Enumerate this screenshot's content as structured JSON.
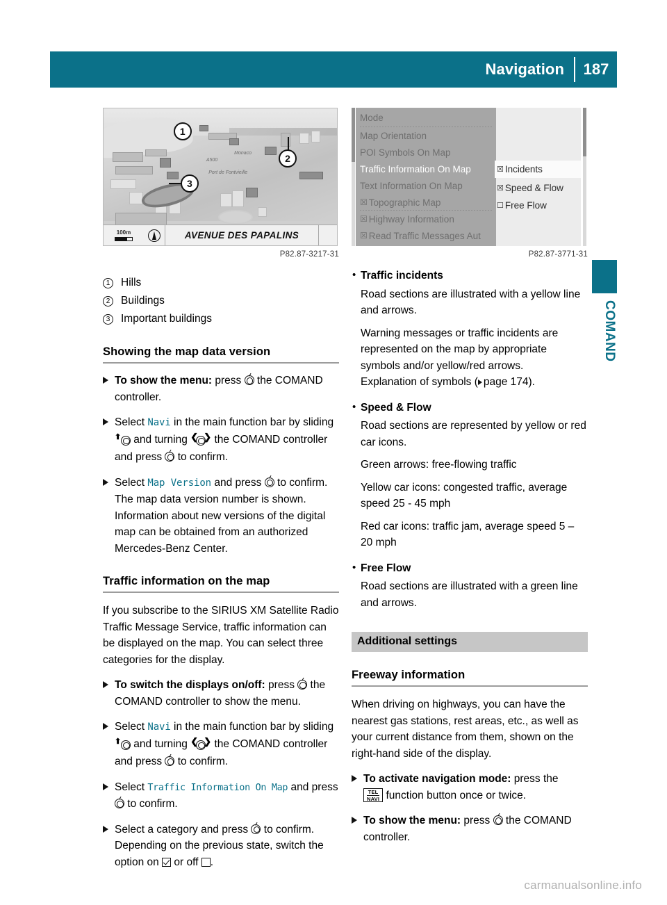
{
  "header": {
    "title": "Navigation",
    "page_number": "187"
  },
  "side_tab": {
    "label": "COMAND"
  },
  "figures": {
    "map": {
      "caption": "P82.87-3217-31",
      "street_label": "AVENUE DES PAPALINS",
      "scale": "100m",
      "place_labels": [
        "Monaco",
        "Port de Fontvieille",
        "A500"
      ],
      "callouts": [
        "1",
        "2",
        "3"
      ]
    },
    "menu": {
      "caption": "P82.87-3771-31",
      "items": [
        {
          "label": "Mode",
          "checkbox": "none",
          "selected": false
        },
        {
          "label": "Map Orientation",
          "checkbox": "none",
          "selected": false
        },
        {
          "label": "POI Symbols On Map",
          "checkbox": "none",
          "selected": false
        },
        {
          "label": "Traffic Information On Map",
          "checkbox": "none",
          "selected": true
        },
        {
          "label": "Text Information On Map",
          "checkbox": "none",
          "selected": false
        },
        {
          "label": "Topographic Map",
          "checkbox": "checked",
          "selected": false
        },
        {
          "label": "Highway Information",
          "checkbox": "checked",
          "selected": false
        },
        {
          "label": "Read Traffic Messages Aut",
          "checkbox": "checked",
          "selected": false
        }
      ],
      "submenu": [
        {
          "label": "Incidents",
          "checkbox": "checked",
          "highlighted": true
        },
        {
          "label": "Speed & Flow",
          "checkbox": "checked",
          "highlighted": false
        },
        {
          "label": "Free Flow",
          "checkbox": "unchecked",
          "highlighted": false
        }
      ]
    }
  },
  "left_column": {
    "legend": [
      {
        "num": "1",
        "text": "Hills"
      },
      {
        "num": "2",
        "text": "Buildings"
      },
      {
        "num": "3",
        "text": "Important buildings"
      }
    ],
    "heading_map_version": "Showing the map data version",
    "steps_map_version": [
      {
        "lead": "To show the menu:",
        "text_a": " press ",
        "text_b": " the COMAND controller."
      },
      {
        "text_a": "Select ",
        "mono": "Navi",
        "text_b": " in the main function bar by sliding ",
        "text_c": " and turning ",
        "text_d": " the COMAND controller and press ",
        "text_e": " to confirm."
      },
      {
        "text_a": "Select ",
        "mono": "Map Version",
        "text_b": " and press ",
        "text_c": " to confirm.",
        "extra": "The map data version number is shown. Information about new versions of the digital map can be obtained from an authorized Mercedes-Benz Center."
      }
    ],
    "heading_traffic": "Traffic information on the map",
    "paragraph_traffic": "If you subscribe to the SIRIUS XM Satellite Radio Traffic Message Service, traffic information can be displayed on the map. You can select three categories for the display.",
    "steps_traffic": [
      {
        "lead": "To switch the displays on/off:",
        "text_a": " press ",
        "text_b": " the COMAND controller to show the menu."
      },
      {
        "text_a": "Select ",
        "mono": "Navi",
        "text_b": " in the main function bar by sliding ",
        "text_c": " and turning ",
        "text_d": " the COMAND controller and press ",
        "text_e": " to confirm."
      },
      {
        "text_a": "Select ",
        "mono": "Traffic Information On Map",
        "text_b": " and press ",
        "text_c": " to confirm."
      },
      {
        "text_a": "Select a category and press ",
        "text_b": " to confirm.",
        "extra_a": "Depending on the previous state, switch the option on ",
        "extra_b": " or off ",
        "extra_c": "."
      }
    ]
  },
  "right_column": {
    "categories": [
      {
        "title": "Traffic incidents",
        "paragraphs": [
          "Road sections are illustrated with a yellow line and arrows.",
          "Warning messages or traffic incidents are represented on the map by appropriate symbols and/or yellow/red arrows."
        ],
        "page_ref_prefix": "Explanation of symbols (",
        "page_ref": "page 174",
        "page_ref_suffix": ")."
      },
      {
        "title": "Speed & Flow",
        "paragraphs": [
          "Road sections are represented by yellow or red car icons.",
          "Green arrows: free-flowing traffic",
          "Yellow car icons: congested traffic, average speed 25 - 45 mph",
          "Red car icons: traffic jam, average speed 5 – 20 mph"
        ]
      },
      {
        "title": "Free Flow",
        "paragraphs": [
          "Road sections are illustrated with a green line and arrows."
        ]
      }
    ],
    "band_title": "Additional settings",
    "heading_freeway": "Freeway information",
    "paragraph_freeway": "When driving on highways, you can have the nearest gas stations, rest areas, etc., as well as your current distance from them, shown on the right-hand side of the display.",
    "steps_freeway": [
      {
        "lead": "To activate navigation mode:",
        "text_a": " press the ",
        "btn_top": "TEL",
        "btn_bottom": "NAVI",
        "text_b": " function button once or twice."
      },
      {
        "lead": "To show the menu:",
        "text_a": " press ",
        "text_b": " the COMAND controller."
      }
    ]
  },
  "watermark": "carmanualsonline.info",
  "colors": {
    "accent_teal": "#0b7189",
    "band_gray": "#c6c6c6",
    "mono_link": "#0b7189"
  }
}
